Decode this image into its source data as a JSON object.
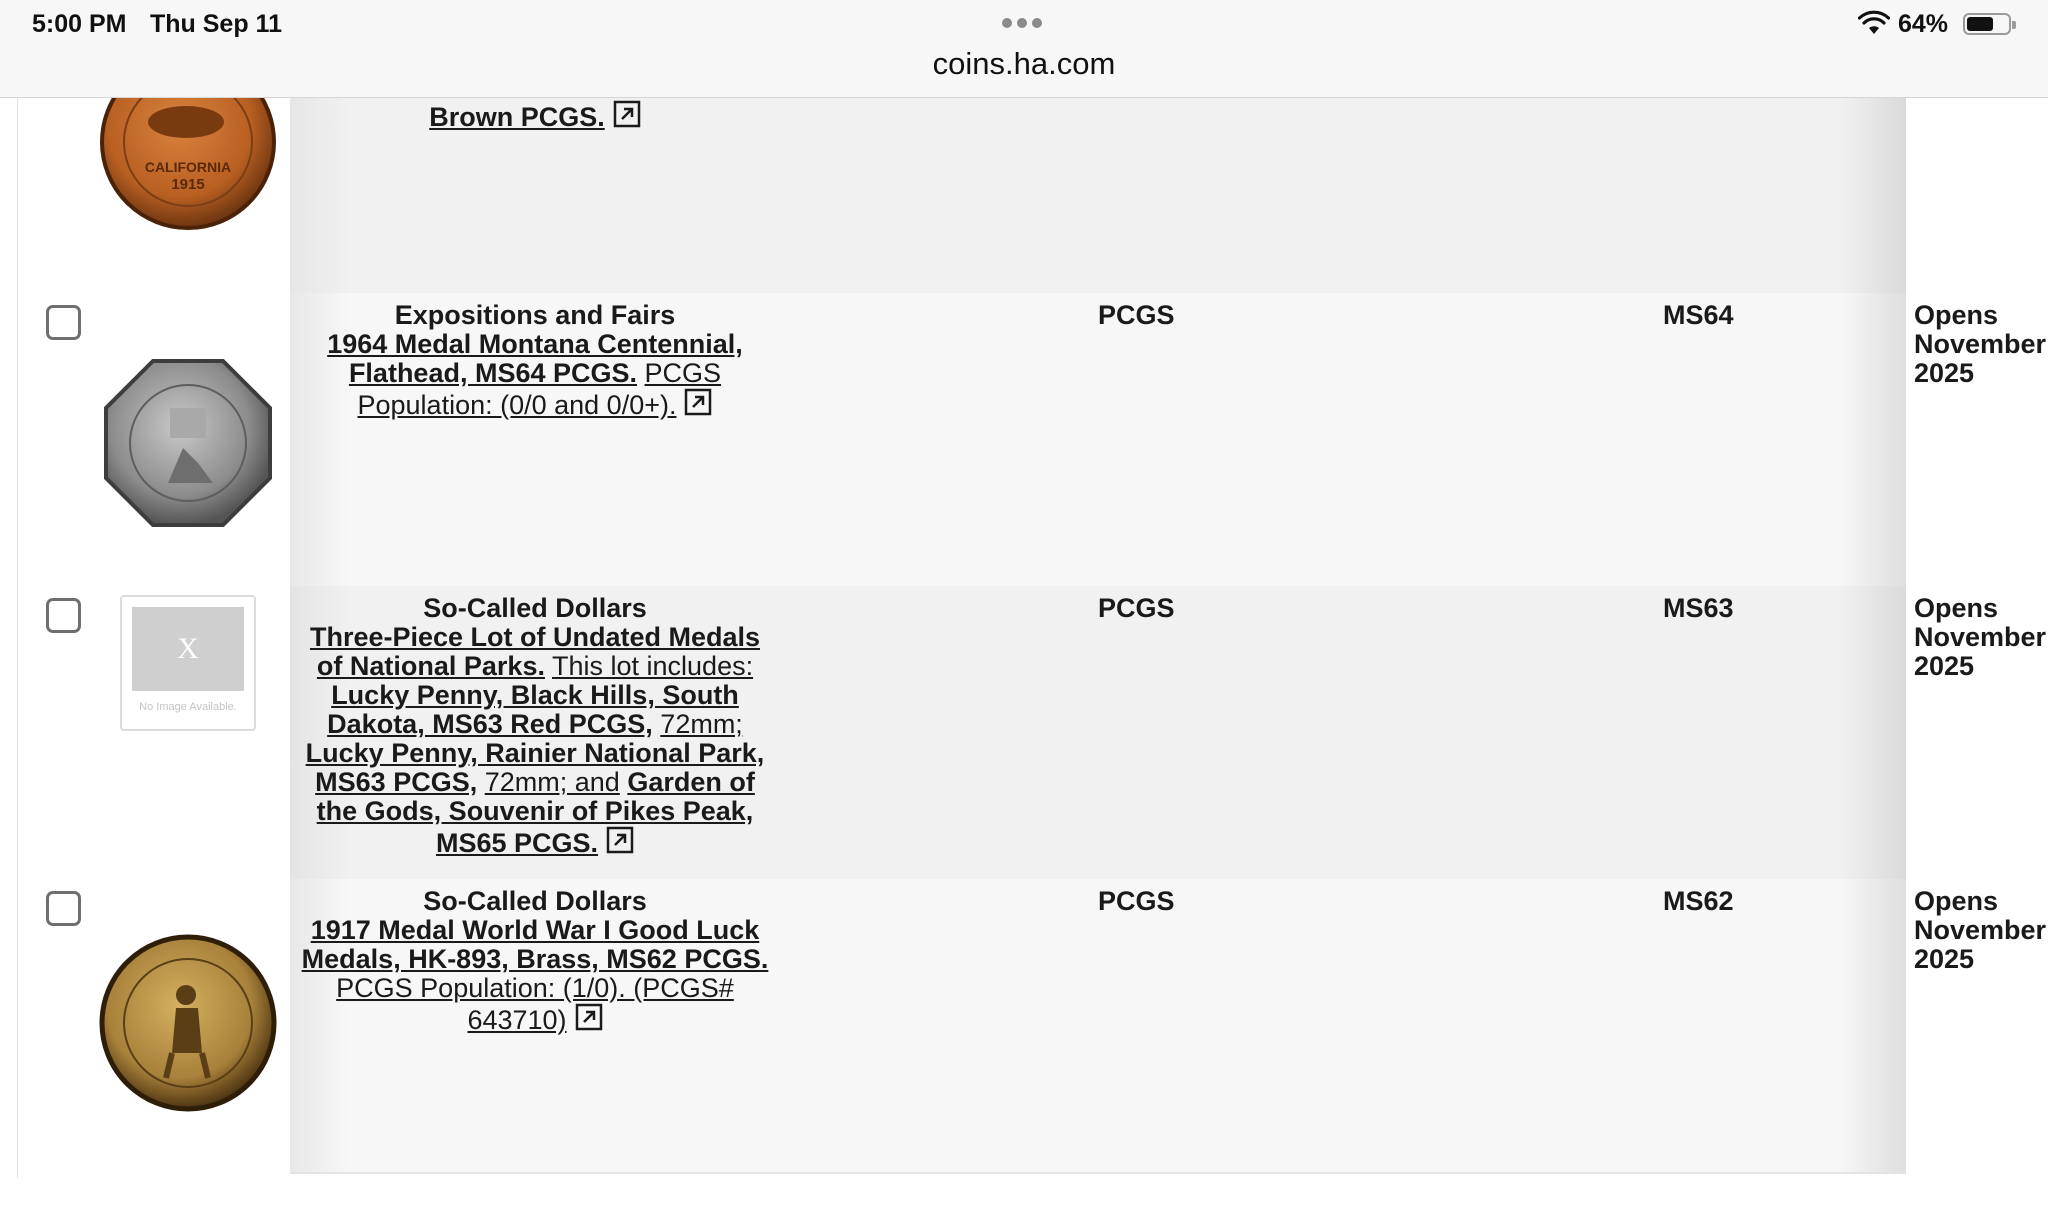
{
  "status_bar": {
    "time": "5:00 PM",
    "date": "Thu Sep 11",
    "battery_percent": "64%",
    "battery_level": 0.64
  },
  "browser": {
    "url": "coins.ha.com"
  },
  "rows": [
    {
      "category": "",
      "title": "Brown PCGS.",
      "extra": "",
      "service": "",
      "grade": "",
      "opens": [
        "",
        "",
        ""
      ],
      "thumb": "california-1915-medal"
    },
    {
      "category": "Expositions and Fairs",
      "title": "1964 Medal Montana Centennial, Flathead, MS64 PCGS.",
      "extra": "PCGS Population: (0/0 and 0/0+).",
      "service": "PCGS",
      "grade": "MS64",
      "opens": [
        "Opens",
        "November",
        "2025"
      ],
      "thumb": "montana-octagonal-medal"
    },
    {
      "category": "So-Called Dollars",
      "title": "Three-Piece Lot of Undated Medals of National Parks.",
      "extra": "This lot includes:",
      "items": [
        {
          "name": "Lucky Penny, Black Hills, South Dakota, MS63 Red PCGS,",
          "note": "72mm;"
        },
        {
          "name": "Lucky Penny, Rainier National Park, MS63 PCGS,",
          "note": "72mm; and"
        },
        {
          "name": "Garden of the Gods, Souvenir of Pikes Peak, MS65 PCGS.",
          "note": ""
        }
      ],
      "service": "PCGS",
      "grade": "MS63",
      "opens": [
        "Opens",
        "November",
        "2025"
      ],
      "thumb_placeholder": {
        "mark": "X",
        "caption": "No Image Available."
      }
    },
    {
      "category": "So-Called Dollars",
      "title": "1917 Medal World War I Good Luck Medals, HK-893, Brass, MS62 PCGS.",
      "extra": "PCGS Population: (1/0). (PCGS# 643710)",
      "service": "PCGS",
      "grade": "MS62",
      "opens": [
        "Opens",
        "November",
        "2025"
      ],
      "thumb": "ww1-good-luck-brass-medal"
    }
  ]
}
